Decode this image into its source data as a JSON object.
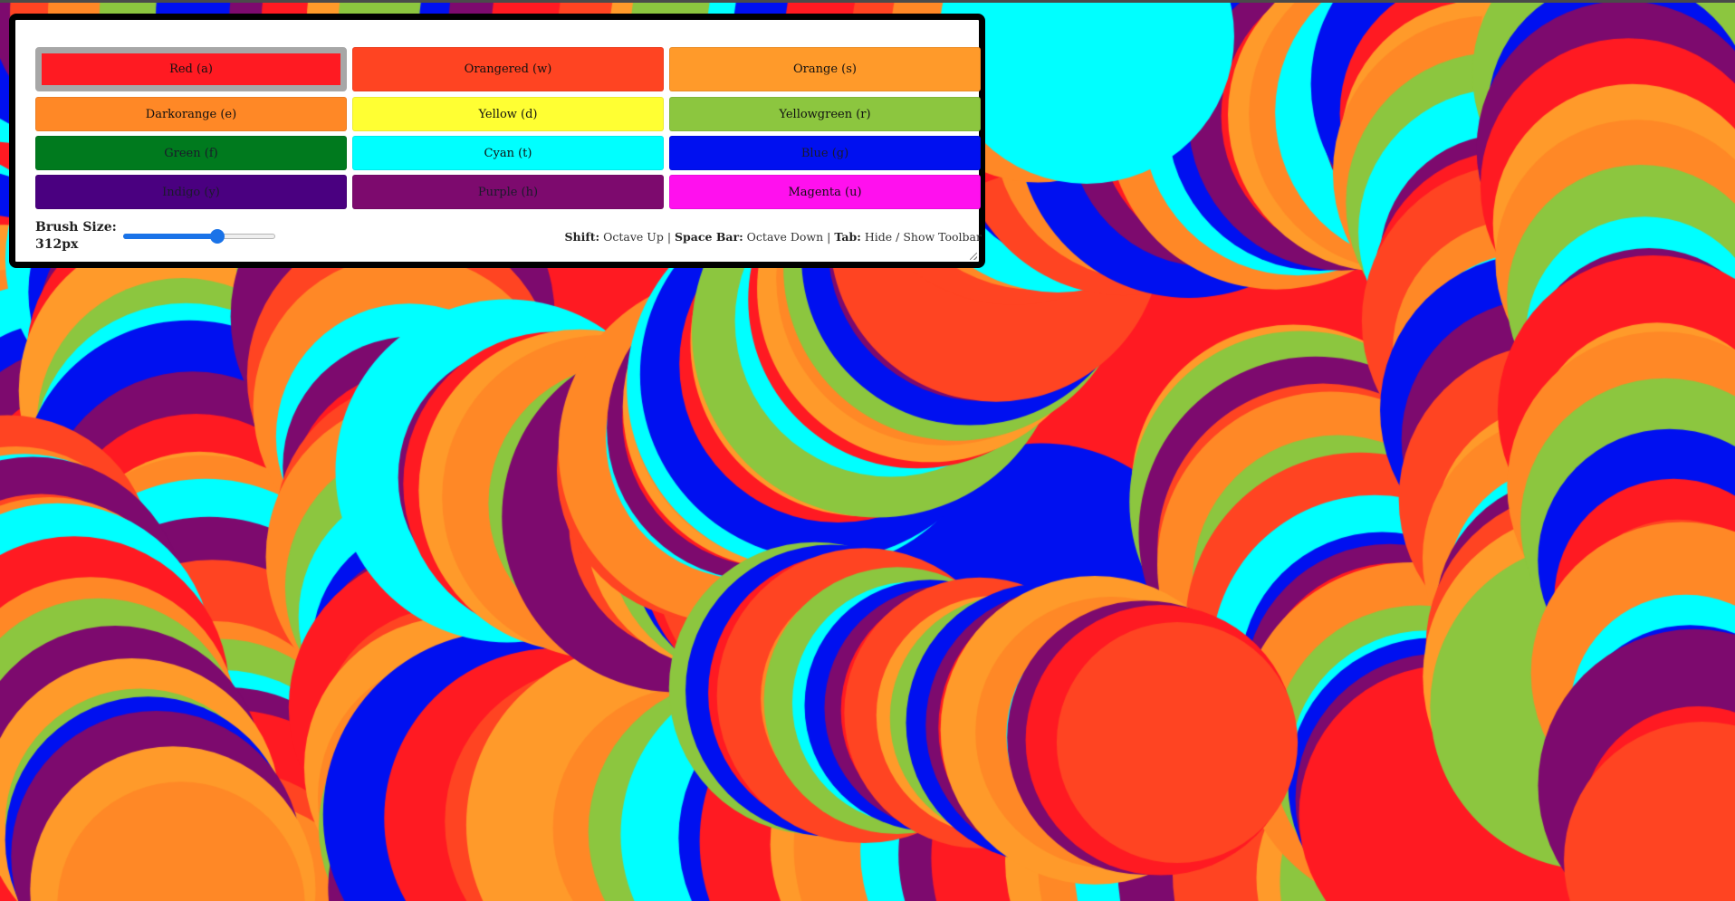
{
  "palette": {
    "red": "#ff1a22",
    "orangered": "#ff4422",
    "orange": "#ff9a2a",
    "darkorange": "#ff8826",
    "yellow": "#ffff33",
    "yellowgreen": "#8cc63f",
    "green": "#007a1e",
    "cyan": "#00ffff",
    "blue": "#0010f0",
    "indigo": "#4a0080",
    "purple": "#7d0a6e",
    "magenta": "#ff10ee"
  },
  "toolbar": {
    "colors": [
      {
        "label": "Red (a)",
        "color": "#ff1a22",
        "selected": true
      },
      {
        "label": "Orangered (w)",
        "color": "#ff4422",
        "selected": false
      },
      {
        "label": "Orange (s)",
        "color": "#ff9a2a",
        "selected": false
      },
      {
        "label": "Darkorange (e)",
        "color": "#ff8826",
        "selected": false
      },
      {
        "label": "Yellow (d)",
        "color": "#ffff33",
        "selected": false
      },
      {
        "label": "Yellowgreen (r)",
        "color": "#8cc63f",
        "selected": false
      },
      {
        "label": "Green (f)",
        "color": "#007a1e",
        "selected": false
      },
      {
        "label": "Cyan (t)",
        "color": "#00ffff",
        "selected": false
      },
      {
        "label": "Blue (g)",
        "color": "#0010f0",
        "selected": false
      },
      {
        "label": "Indigo (y)",
        "color": "#4a0080",
        "selected": false
      },
      {
        "label": "Purple (h)",
        "color": "#7d0a6e",
        "selected": false
      },
      {
        "label": "Magenta (u)",
        "color": "#ff10ee",
        "selected": false
      }
    ],
    "brush_label": "Brush Size:",
    "brush_value": "312px",
    "brush_slider_fraction": 0.62,
    "shortcuts": {
      "shift_key": "Shift:",
      "shift_action": "Octave Up",
      "sep1": "|",
      "space_key": "Space Bar:",
      "space_action": "Octave Down",
      "sep2": "|",
      "tab_key": "Tab:",
      "tab_action": "Hide / Show Toolbar"
    }
  }
}
